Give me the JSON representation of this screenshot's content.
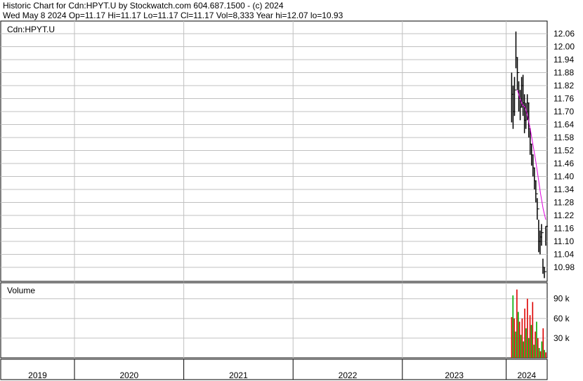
{
  "header": {
    "line1": "Historic Chart for Cdn:HPYT.U by Stockwatch.com 604.687.1500 - (c) 2024",
    "line2": "Wed May  8 2024   Op=11.17   Hi=11.17   Lo=11.17   Cl=11.17   Vol=8,333   Year hi=12.07   lo=10.93"
  },
  "price_panel": {
    "label": "Cdn:HPYT.U"
  },
  "volume_panel": {
    "label": "Volume"
  },
  "colors": {
    "background": "#ffffff",
    "grid": "#c0c0c0",
    "frame": "#000000",
    "price_bar": "#000000",
    "moving_average": "#e000e0",
    "volume_up": "#00aa00",
    "volume_down": "#dd0000"
  },
  "chart_data": [
    {
      "type": "line",
      "subtype": "ohlc",
      "title": "Historic Chart for Cdn:HPYT.U by Stockwatch.com 604.687.1500 - (c) 2024",
      "ylim": [
        10.93,
        12.08
      ],
      "y_ticks": [
        "12.06",
        "12.00",
        "11.94",
        "11.88",
        "11.82",
        "11.76",
        "11.70",
        "11.64",
        "11.58",
        "11.52",
        "11.46",
        "11.40",
        "11.34",
        "11.28",
        "11.22",
        "11.16",
        "11.10",
        "11.04",
        "10.98"
      ],
      "x_ticks": [
        "2019",
        "2020",
        "2021",
        "2022",
        "2023",
        "2024"
      ],
      "x_tick_fraction": [
        0.0,
        0.135,
        0.335,
        0.535,
        0.735,
        0.925
      ],
      "grid": true,
      "start_fraction": 0.935,
      "series": [
        {
          "values_hlc": [
            [
              11.88,
              11.65,
              11.78
            ],
            [
              11.82,
              11.62,
              11.7
            ],
            [
              11.86,
              11.68,
              11.8
            ],
            [
              12.07,
              11.9,
              11.95
            ],
            [
              11.95,
              11.8,
              11.88
            ],
            [
              11.84,
              11.7,
              11.76
            ],
            [
              11.8,
              11.66,
              11.72
            ],
            [
              11.86,
              11.72,
              11.82
            ],
            [
              11.87,
              11.68,
              11.74
            ],
            [
              11.78,
              11.6,
              11.66
            ],
            [
              11.74,
              11.62,
              11.7
            ],
            [
              11.78,
              11.66,
              11.74
            ],
            [
              11.74,
              11.58,
              11.62
            ],
            [
              11.62,
              11.5,
              11.55
            ],
            [
              11.55,
              11.45,
              11.5
            ],
            [
              11.5,
              11.4,
              11.44
            ],
            [
              11.44,
              11.34,
              11.38
            ],
            [
              11.38,
              11.28,
              11.32
            ],
            [
              11.3,
              11.2,
              11.25
            ],
            [
              11.2,
              11.05,
              11.1
            ],
            [
              11.15,
              11.04,
              11.12
            ],
            [
              11.18,
              11.08,
              11.14
            ],
            [
              11.02,
              10.95,
              10.98
            ],
            [
              10.98,
              10.93,
              10.96
            ],
            [
              11.17,
              11.08,
              11.17
            ]
          ]
        },
        {
          "name": "",
          "moving_average": [
            11.8,
            11.76,
            11.73,
            11.72,
            11.68,
            11.62,
            11.55,
            11.48,
            11.4,
            11.32,
            11.25,
            11.2
          ]
        }
      ]
    },
    {
      "type": "bar",
      "title": "Volume",
      "ylim": [
        0,
        110000
      ],
      "y_ticks": [
        "90 k",
        "60 k",
        "30 k"
      ],
      "y_tick_values": [
        90000,
        60000,
        30000
      ],
      "series": [
        {
          "name": "",
          "values": [
            62000,
            95000,
            60000,
            40000,
            104000,
            70000,
            55000,
            35000,
            60000,
            25000,
            75000,
            45000,
            90000,
            30000,
            65000,
            50000,
            85000,
            20000,
            40000,
            55000,
            30000,
            15000,
            10000,
            25000,
            45000,
            12000,
            8333
          ]
        }
      ]
    }
  ]
}
